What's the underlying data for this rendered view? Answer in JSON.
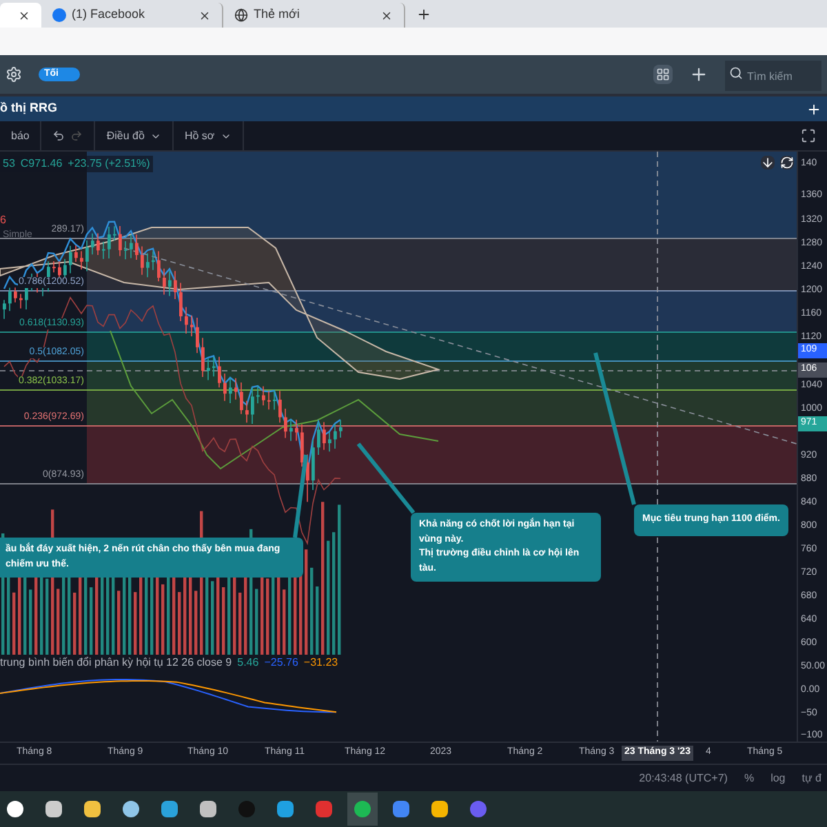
{
  "browser_tabs": [
    {
      "selected": true
    },
    {
      "title": "(1) Facebook",
      "selected": false
    },
    {
      "title": "Thẻ mới",
      "selected": false
    }
  ],
  "toolbar": {
    "theme_toggle": {
      "label": "Tối",
      "on": true
    },
    "search": {
      "placeholder": "Tìm kiếm"
    }
  },
  "panel": {
    "title": "ồ thị RRG"
  },
  "chart_toolbar": {
    "items": [
      "báo",
      "Điều đồ",
      "Hồ sơ"
    ]
  },
  "legend": {
    "prefix": "53",
    "close": "C971.46",
    "change": "+23.75 (+2.51%)"
  },
  "indicator_marks": [
    "6",
    "Simple"
  ],
  "fib_levels": [
    {
      "label": "289.17)"
    },
    {
      "label": "0.786(1200.52)"
    },
    {
      "label": "0.618(1130.93)"
    },
    {
      "label": "0.5(1082.05)"
    },
    {
      "label": "0.382(1033.17)"
    },
    {
      "label": "0.236(972.69)"
    },
    {
      "label": "0(874.93)"
    }
  ],
  "callouts": [
    {
      "text": "ầu bắt đáy xuất hiện, 2 nến rút chân cho thấy bên mua đang chiếm ưu thế."
    },
    {
      "text": "Khả năng có chốt lời ngắn hạn tại vùng này.\nThị trường điều chỉnh là cơ hội lên tàu."
    },
    {
      "text": "Mục tiêu trung hạn 1100 điểm."
    }
  ],
  "macd": {
    "label": "trung bình biến đổi phân kỳ hội tụ 12 26 close 9",
    "values": [
      {
        "text": "5.46",
        "color": "#26a69a"
      },
      {
        "text": "−25.76",
        "color": "#2962ff"
      },
      {
        "text": "−31.23",
        "color": "#ff9800"
      }
    ]
  },
  "price_axis": {
    "labels": [
      "140",
      "1360",
      "1320",
      "1280",
      "1240",
      "1200",
      "1160",
      "1120",
      "1040",
      "1000",
      "920",
      "880",
      "840",
      "800",
      "760",
      "720",
      "680",
      "640",
      "600",
      "50.00",
      "0.00",
      "−50",
      "−100"
    ],
    "tags": [
      {
        "text": "109",
        "color": "#2962ff"
      },
      {
        "text": "106",
        "color": "#4a4e5a"
      },
      {
        "text": "971",
        "color": "#26a69a"
      }
    ]
  },
  "time_axis": {
    "labels": [
      {
        "text": "Tháng 8",
        "selected": false
      },
      {
        "text": "Tháng 9",
        "selected": false
      },
      {
        "text": "Tháng 10",
        "selected": false
      },
      {
        "text": "Tháng 11",
        "selected": false
      },
      {
        "text": "Tháng 12",
        "selected": false
      },
      {
        "text": "2023",
        "selected": false
      },
      {
        "text": "Tháng 2",
        "selected": false
      },
      {
        "text": "Tháng 3",
        "selected": false
      },
      {
        "text": "23 Tháng 3 '23",
        "selected": true
      },
      {
        "text": "4",
        "selected": false
      },
      {
        "text": "Tháng 5",
        "selected": false
      }
    ]
  },
  "status_bar": {
    "time": "20:43:48 (UTC+7)",
    "buttons": [
      "%",
      "log",
      "tự đ"
    ]
  },
  "taskbar": {
    "apps": [
      {
        "selected": false
      },
      {
        "selected": false
      },
      {
        "selected": false
      },
      {
        "selected": false
      },
      {
        "selected": false
      },
      {
        "selected": false
      },
      {
        "selected": false
      },
      {
        "selected": false
      },
      {
        "selected": false
      },
      {
        "selected": true
      },
      {
        "selected": false
      },
      {
        "selected": false
      },
      {
        "selected": false
      }
    ]
  }
}
